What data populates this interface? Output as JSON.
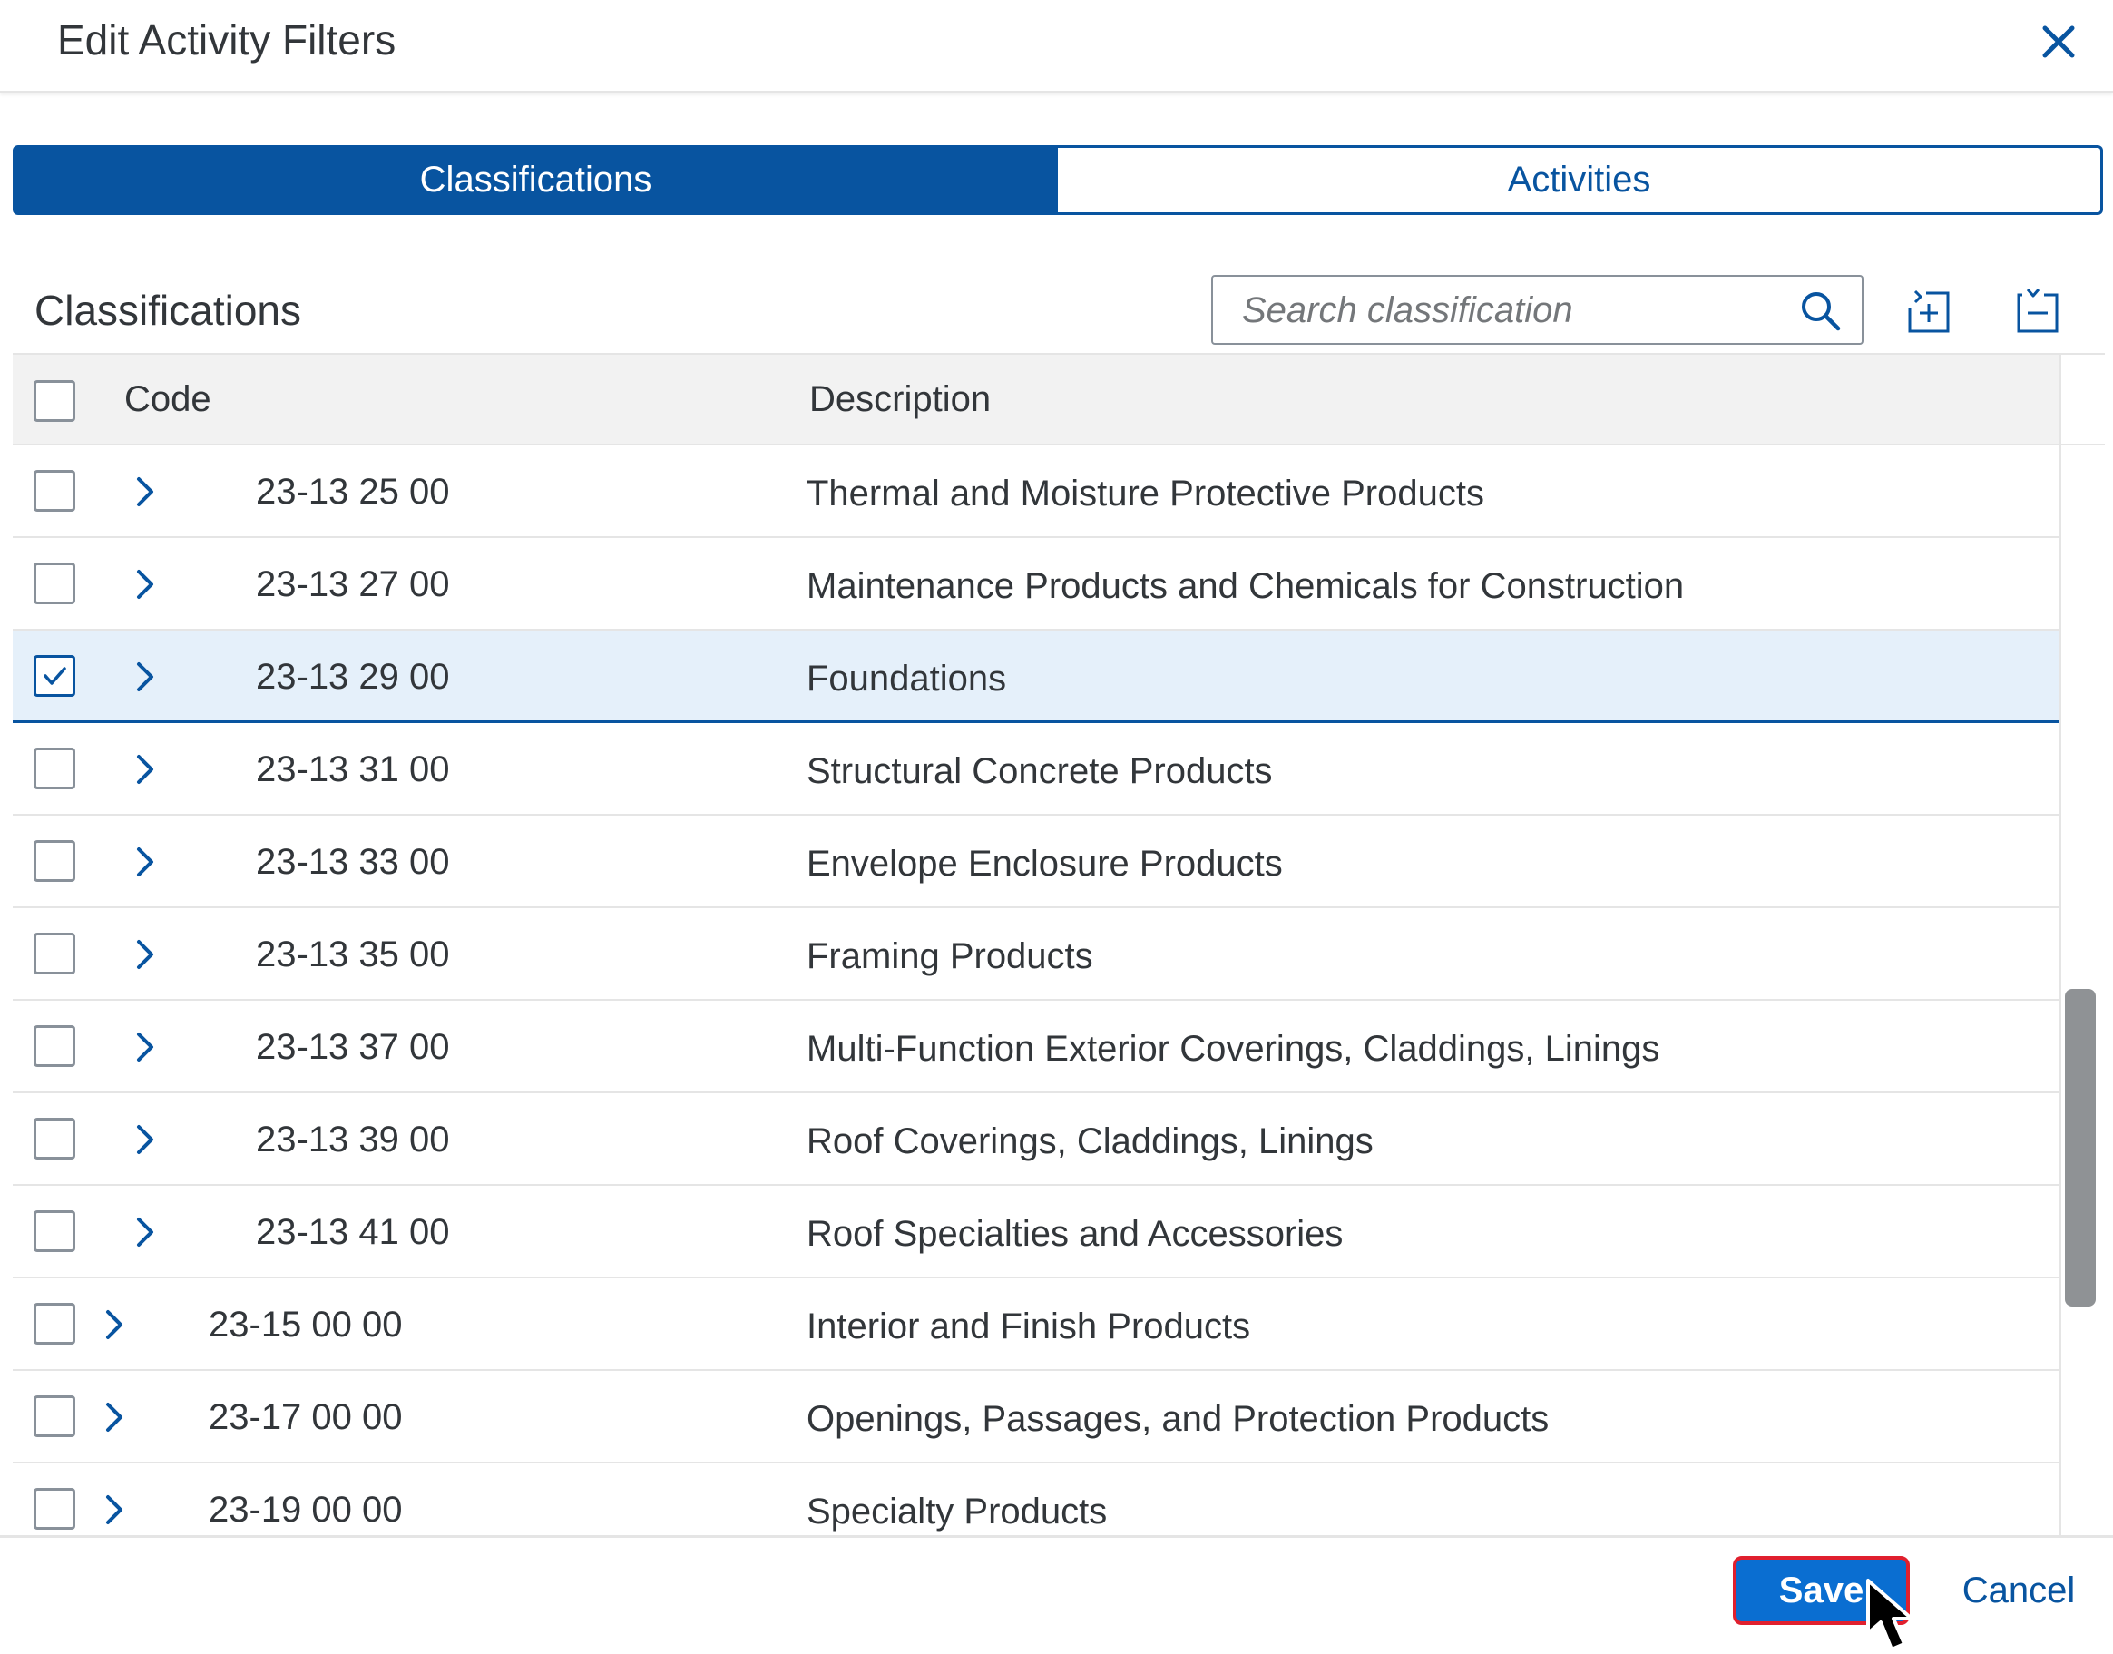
{
  "dialog": {
    "title": "Edit Activity Filters"
  },
  "tabs": [
    {
      "label": "Classifications",
      "active": true
    },
    {
      "label": "Activities",
      "active": false
    }
  ],
  "section": {
    "title": "Classifications"
  },
  "search": {
    "placeholder": "Search classification",
    "value": ""
  },
  "toolbar": {
    "expand_all_icon": "expand-all-icon",
    "collapse_all_icon": "collapse-all-icon"
  },
  "table": {
    "headers": {
      "code": "Code",
      "description": "Description"
    },
    "rows": [
      {
        "code": "23-13 25 00",
        "description": "Thermal and Moisture Protective Products",
        "level": 2,
        "checked": false
      },
      {
        "code": "23-13 27 00",
        "description": "Maintenance Products and Chemicals for Construction",
        "level": 2,
        "checked": false
      },
      {
        "code": "23-13 29 00",
        "description": "Foundations",
        "level": 2,
        "checked": true
      },
      {
        "code": "23-13 31 00",
        "description": "Structural Concrete Products",
        "level": 2,
        "checked": false
      },
      {
        "code": "23-13 33 00",
        "description": "Envelope Enclosure Products",
        "level": 2,
        "checked": false
      },
      {
        "code": "23-13 35 00",
        "description": "Framing Products",
        "level": 2,
        "checked": false
      },
      {
        "code": "23-13 37 00",
        "description": "Multi-Function Exterior Coverings, Claddings, Linings",
        "level": 2,
        "checked": false
      },
      {
        "code": "23-13 39 00",
        "description": "Roof Coverings, Claddings, Linings",
        "level": 2,
        "checked": false
      },
      {
        "code": "23-13 41 00",
        "description": "Roof Specialties and Accessories",
        "level": 2,
        "checked": false
      },
      {
        "code": "23-15 00 00",
        "description": "Interior and Finish Products",
        "level": 1,
        "checked": false
      },
      {
        "code": "23-17 00 00",
        "description": "Openings, Passages, and Protection Products",
        "level": 1,
        "checked": false
      },
      {
        "code": "23-19 00 00",
        "description": "Specialty Products",
        "level": 1,
        "checked": false
      }
    ]
  },
  "footer": {
    "save_label": "Save",
    "cancel_label": "Cancel"
  },
  "colors": {
    "accent": "#0854a0",
    "emphasized_button": "#0a6ed1",
    "highlight_outline": "#e0202e",
    "selected_row": "#e5f0fa",
    "header_bg": "#f2f2f2"
  }
}
